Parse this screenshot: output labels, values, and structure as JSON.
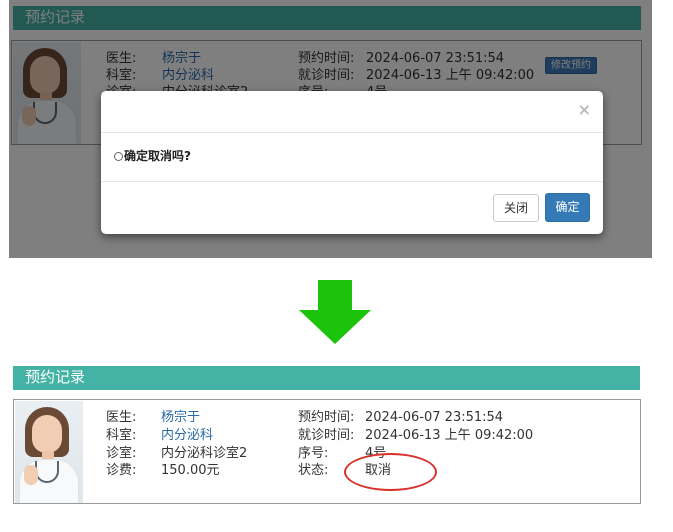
{
  "before": {
    "section_title": "预约记录",
    "card": {
      "doctor_label": "医生:",
      "doctor_value": "杨宗于",
      "dept_label": "科室:",
      "dept_value": "内分泌科",
      "room_label": "诊室:",
      "room_value": "内分泌科诊室2",
      "book_time_label": "预约时间:",
      "book_time_value": "2024-06-07 23:51:54",
      "visit_time_label": "就诊时间:",
      "visit_time_value": "2024-06-13 上午 09:42:00",
      "seq_label": "序号:",
      "seq_value": "4号",
      "edit_button": "修改预约"
    },
    "modal": {
      "close_symbol": "×",
      "message": "确定取消吗?",
      "close_button": "关闭",
      "confirm_button": "确定"
    }
  },
  "after": {
    "section_title": "预约记录",
    "card": {
      "doctor_label": "医生:",
      "doctor_value": "杨宗于",
      "dept_label": "科室:",
      "dept_value": "内分泌科",
      "room_label": "诊室:",
      "room_value": "内分泌科诊室2",
      "fee_label": "诊费:",
      "fee_value": "150.00元",
      "book_time_label": "预约时间:",
      "book_time_value": "2024-06-07 23:51:54",
      "visit_time_label": "就诊时间:",
      "visit_time_value": "2024-06-13 上午 09:42:00",
      "seq_label": "序号:",
      "seq_value": "4号",
      "status_label": "状态:",
      "status_value": "取消"
    }
  },
  "colors": {
    "header_teal": "#44b2a5",
    "link_blue": "#2a6aa8",
    "primary_button": "#337ab7",
    "arrow_green": "#1bc40a",
    "highlight_red": "#d9302b"
  },
  "icons": {
    "modal_close": "close-icon",
    "transition_arrow": "arrow-down-icon",
    "avatar": "doctor-avatar-image"
  }
}
